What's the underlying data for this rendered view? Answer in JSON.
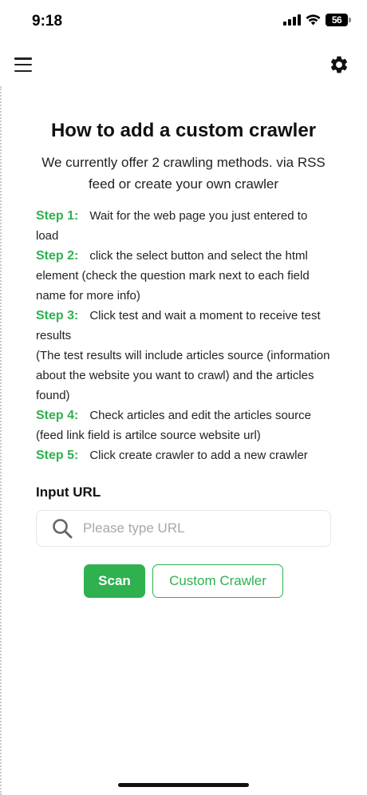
{
  "status_bar": {
    "time": "9:18",
    "battery_level": "56"
  },
  "header": {
    "menu_icon": "hamburger-menu-icon",
    "settings_icon": "gear-icon"
  },
  "main": {
    "title": "How to add a custom crawler",
    "subtitle": "We currently offer 2 crawling methods. via RSS feed or create your own crawler",
    "steps": [
      {
        "label": "Step 1:",
        "text": "Wait for the web page you just entered to load"
      },
      {
        "label": "Step 2:",
        "text": "click the select button and select the html element (check the question mark next to each field name for more info)"
      },
      {
        "label": "Step 3:",
        "text": "Click test and wait a moment to receive test results",
        "extra": "(The test results will include articles source (information about the website you want to crawl) and the articles found)"
      },
      {
        "label": "Step 4:",
        "text": "Check articles and edit the articles source (feed link field is artilce source website url)"
      },
      {
        "label": "Step 5:",
        "text": "Click create crawler to add a new crawler"
      }
    ],
    "input_label": "Input URL",
    "search": {
      "placeholder": "Please type URL",
      "value": "",
      "icon": "search-icon"
    },
    "buttons": {
      "scan_label": "Scan",
      "custom_label": "Custom Crawler"
    }
  },
  "colors": {
    "accent": "#2fb14f",
    "text": "#222222",
    "placeholder": "#a8a8a8"
  }
}
